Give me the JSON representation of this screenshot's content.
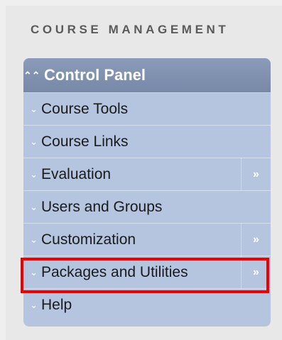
{
  "section_heading": "COURSE MANAGEMENT",
  "control_panel": {
    "title": "Control Panel",
    "expand_glyph": "«",
    "items": [
      {
        "label": "Course Tools",
        "has_submenu": false
      },
      {
        "label": "Course Links",
        "has_submenu": false
      },
      {
        "label": "Evaluation",
        "has_submenu": true
      },
      {
        "label": "Users and Groups",
        "has_submenu": false
      },
      {
        "label": "Customization",
        "has_submenu": true
      },
      {
        "label": "Packages and Utilities",
        "has_submenu": true,
        "highlighted": true
      },
      {
        "label": "Help",
        "has_submenu": false
      }
    ]
  },
  "colors": {
    "panel_bg": "#b5c4df",
    "header_bg": "#7f90af",
    "highlight_border": "#ee0000"
  },
  "icons": {
    "collapse": "double-chevron-up-icon",
    "expand": "double-chevron-down-icon",
    "submenu": "double-chevron-right-icon"
  }
}
